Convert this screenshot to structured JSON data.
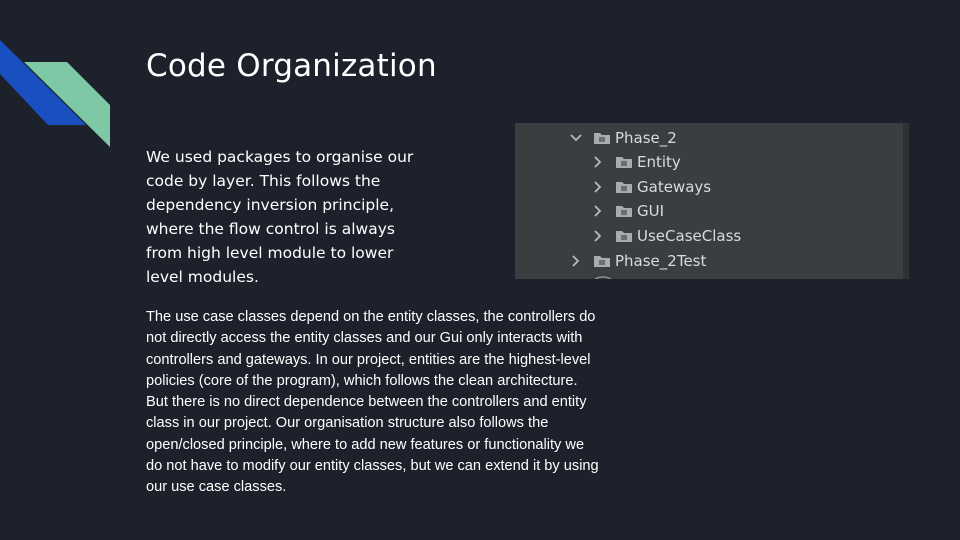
{
  "slide": {
    "title": "Code Organization",
    "intro": "We used packages to organise our code by layer. This follows the dependency inversion principle, where the flow control is always from high level module to lower level modules.",
    "body": "The use case classes depend on the entity classes, the controllers do not directly access the entity classes and our Gui only interacts with controllers and gateways. In our project, entities are the highest-level policies  (core of the program), which follows the clean architecture. But there is no direct dependence between the controllers and entity class in our project. Our organisation structure also follows the open/closed principle, where to add new features or functionality we do not have to modify our entity classes, but we can extend it by using our use case classes."
  },
  "project_tree": {
    "items": [
      {
        "label": "Phase_2",
        "icon": "folder-icon",
        "chevron": "chevron-down-icon",
        "expanded": true
      },
      {
        "label": "Entity",
        "icon": "folder-icon",
        "chevron": "chevron-right-icon",
        "expanded": false
      },
      {
        "label": "Gateways",
        "icon": "folder-icon",
        "chevron": "chevron-right-icon",
        "expanded": false
      },
      {
        "label": "GUI",
        "icon": "folder-icon",
        "chevron": "chevron-right-icon",
        "expanded": false
      },
      {
        "label": "UseCaseClass",
        "icon": "folder-icon",
        "chevron": "chevron-right-icon",
        "expanded": false
      },
      {
        "label": "Phase_2Test",
        "icon": "folder-icon",
        "chevron": "chevron-right-icon",
        "expanded": false
      }
    ]
  },
  "colors": {
    "background": "#1c212b",
    "accent_blue": "#1a4fbf",
    "accent_green": "#7fc8a6",
    "tree_background": "#3b3e41",
    "tree_text": "#d9dadb"
  }
}
